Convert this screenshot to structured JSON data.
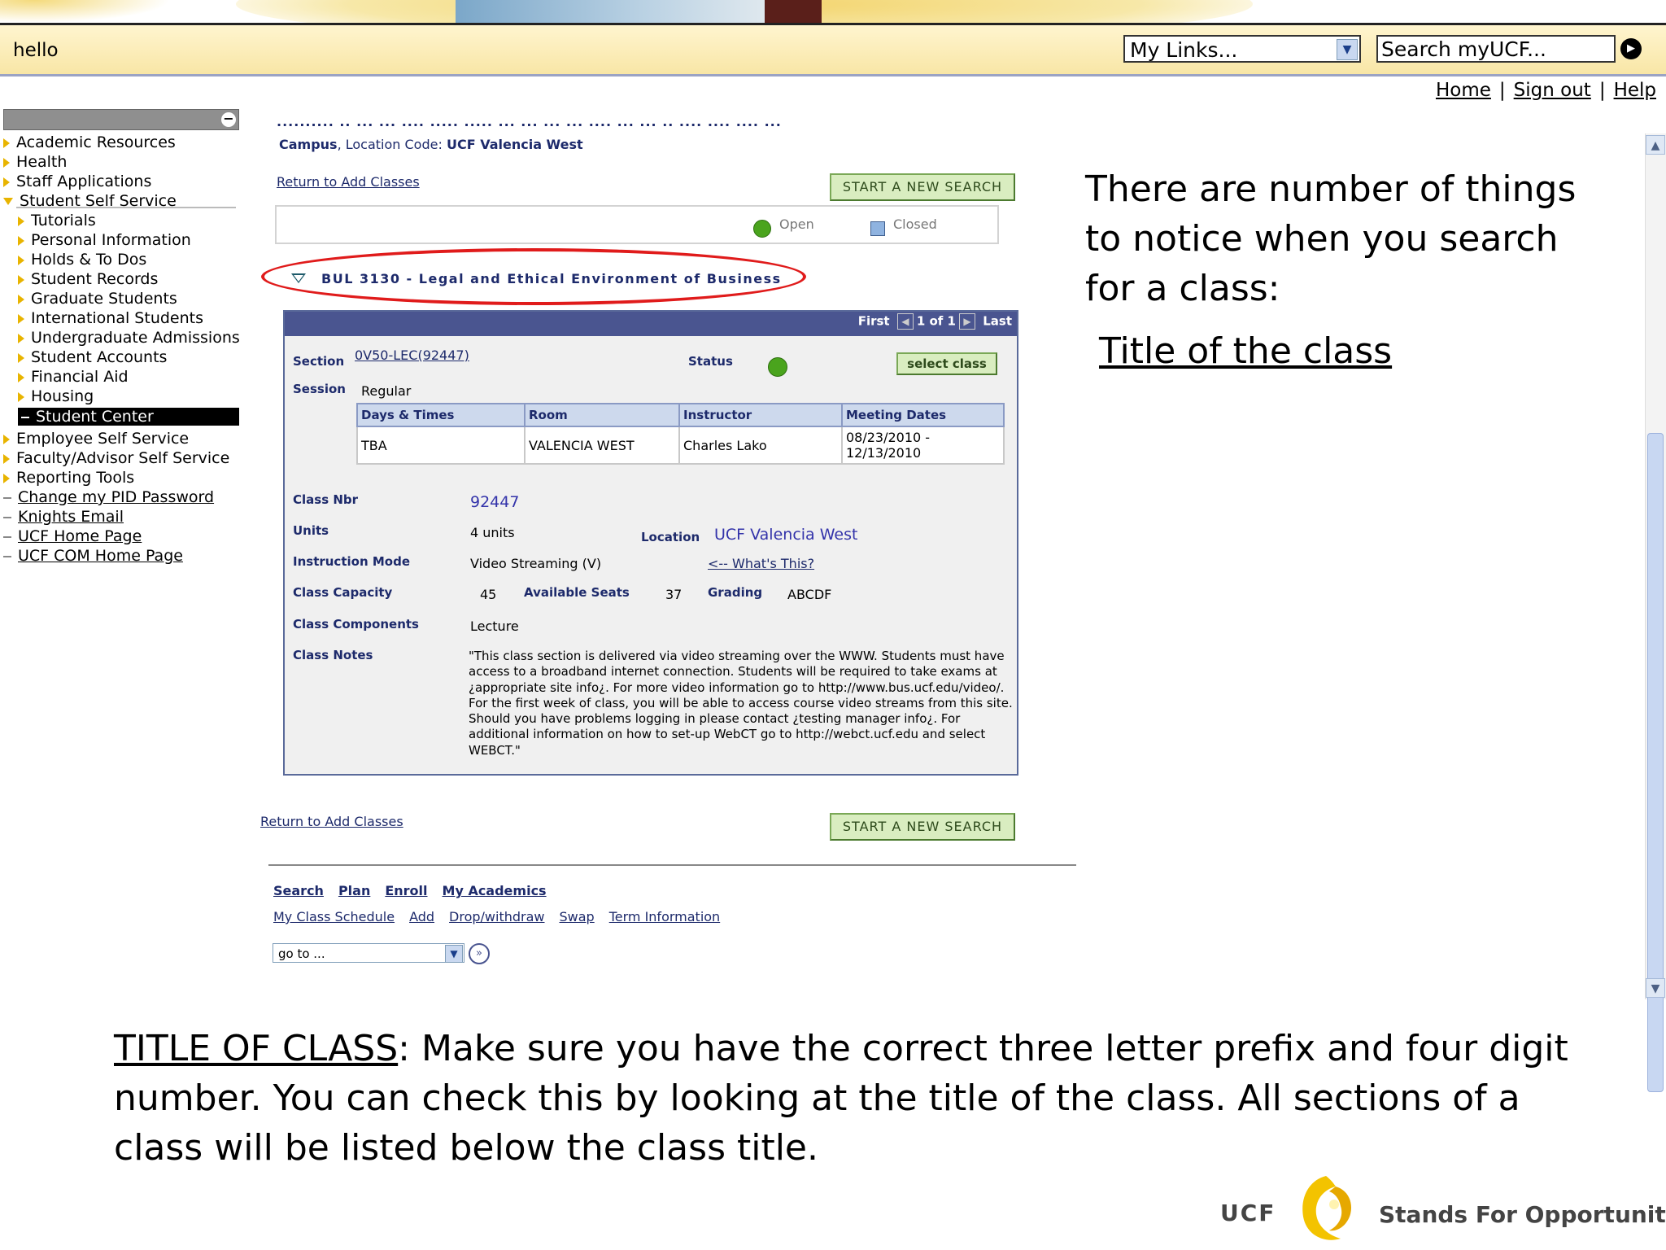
{
  "topbar": {
    "greeting": "hello",
    "mylinks": "My Links...",
    "search_placeholder": "Search myUCF..."
  },
  "toplinks": [
    "Home",
    "Sign out",
    "Help"
  ],
  "sidebar": {
    "items": [
      {
        "label": "Academic Resources",
        "kind": "tri",
        "level": 0
      },
      {
        "label": "Health",
        "kind": "tri",
        "level": 0
      },
      {
        "label": "Staff Applications",
        "kind": "tri",
        "level": 0
      },
      {
        "label": "Student Self Service",
        "kind": "tridown",
        "level": 0
      },
      {
        "label": "Tutorials",
        "kind": "tri",
        "level": 1
      },
      {
        "label": "Personal Information",
        "kind": "tri",
        "level": 1
      },
      {
        "label": "Holds & To Dos",
        "kind": "tri",
        "level": 1
      },
      {
        "label": "Student Records",
        "kind": "tri",
        "level": 1
      },
      {
        "label": "Graduate Students",
        "kind": "tri",
        "level": 1
      },
      {
        "label": "International Students",
        "kind": "tri",
        "level": 1
      },
      {
        "label": "Undergraduate Admissions",
        "kind": "tri",
        "level": 1
      },
      {
        "label": "Student Accounts",
        "kind": "tri",
        "level": 1
      },
      {
        "label": "Financial Aid",
        "kind": "tri",
        "level": 1
      },
      {
        "label": "Housing",
        "kind": "tri",
        "level": 1
      },
      {
        "label": "Student Center",
        "kind": "active",
        "level": 1
      },
      {
        "label": "Employee Self Service",
        "kind": "tri",
        "level": 0
      },
      {
        "label": "Faculty/Advisor Self Service",
        "kind": "tri",
        "level": 0
      },
      {
        "label": "Reporting Tools",
        "kind": "tri",
        "level": 0
      },
      {
        "label": "Change my PID Password",
        "kind": "link",
        "level": 0
      },
      {
        "label": "Knights Email",
        "kind": "link",
        "level": 0
      },
      {
        "label": "UCF Home Page",
        "kind": "link",
        "level": 0
      },
      {
        "label": "UCF COM Home Page",
        "kind": "link",
        "level": 0
      }
    ]
  },
  "search": {
    "campus_label": "Campus",
    "campus_rest": ",  Location Code: ",
    "campus_value": "UCF Valencia West",
    "return_link": "Return to Add Classes",
    "new_search": "START A NEW SEARCH",
    "legend_open": "Open",
    "legend_closed": "Closed",
    "class_title": "BUL 3130 - Legal and Ethical Environment of Business"
  },
  "panel": {
    "first": "First",
    "pager": "1 of 1",
    "last": "Last",
    "section_label": "Section",
    "section_value": "0V50-LEC(92447)",
    "status_label": "Status",
    "select_class": "select class",
    "session_label": "Session",
    "session_value": "Regular",
    "table": {
      "headers": [
        "Days & Times",
        "Room",
        "Instructor",
        "Meeting Dates"
      ],
      "row": [
        "TBA",
        "VALENCIA WEST",
        "Charles Lako",
        "08/23/2010 -\n12/13/2010"
      ]
    },
    "class_nbr_label": "Class Nbr",
    "class_nbr_value": "92447",
    "units_label": "Units",
    "units_value": "4 units",
    "location_label": "Location",
    "location_value": "UCF Valencia West",
    "mode_label": "Instruction Mode",
    "mode_value": "Video Streaming (V)",
    "whats_this": "<-- What's This?",
    "capacity_label": "Class Capacity",
    "capacity_value": "45",
    "seats_label": "Available Seats",
    "seats_value": "37",
    "grading_label": "Grading",
    "grading_value": "ABCDF",
    "components_label": "Class Components",
    "components_value": "Lecture",
    "notes_label": "Class Notes",
    "notes_value": "\"This class section is delivered via video streaming over the WWW. Students must have access to a broadband internet connection.  Students will be required to take exams at ¿appropriate site info¿.  For more video information go to http://www.bus.ucf.edu/video/.  For the first week of class, you will be able to access course video streams from this site. Should you have problems logging in please contact ¿testing manager info¿.  For additional information on how to set-up WebCT  go to http://webct.ucf.edu and select WEBCT.\""
  },
  "bottom_nav": {
    "primary": [
      "Search",
      "Plan",
      "Enroll",
      "My Academics"
    ],
    "secondary": [
      "My Class Schedule",
      "Add",
      "Drop/withdraw",
      "Swap",
      "Term Information"
    ],
    "goto": "go to ..."
  },
  "annotations": {
    "right_text": "There are number of things to notice when you search for a class:",
    "right_title": "Title of the class",
    "bottom_title": "TITLE OF CLASS",
    "bottom_text": ": Make sure you have the correct three letter prefix and four digit number. You can check this by looking at the title of the class. All sections of a class will be listed below the class title."
  },
  "branding": {
    "ucf": "UCF",
    "tagline": "Stands For Opportunity"
  },
  "colors": {
    "nav_bullet": "#e8b400",
    "panel_header": "#4a5590",
    "highlight_oval": "#e01b1b",
    "open_dot": "#4aa41d"
  }
}
